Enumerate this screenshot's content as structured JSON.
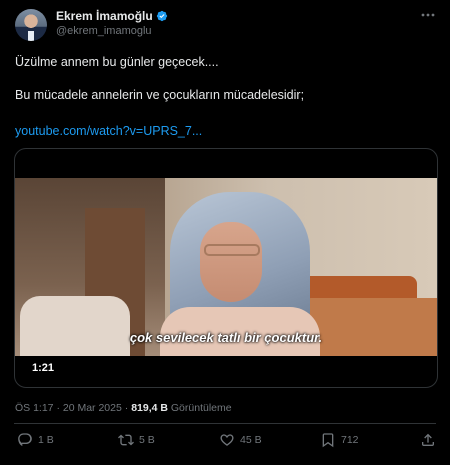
{
  "header": {
    "name": "Ekrem İmamoğlu",
    "handle": "@ekrem_imamoglu"
  },
  "body": {
    "line1": "Üzülme annem bu günler geçecek....",
    "line2": "Bu mücadele annelerin ve çocukların mücadelesidir;",
    "link": "youtube.com/watch?v=UPRS_7..."
  },
  "media": {
    "subtitle": "çok sevilecek tatlı bir çocuktur.",
    "duration": "1:21"
  },
  "meta": {
    "time": "ÖS 1:17",
    "date": "20 Mar 2025",
    "views": "819,4 B",
    "views_label": "Görüntüleme"
  },
  "actions": {
    "replies": "1 B",
    "reposts": "5 B",
    "likes": "45 B",
    "views": "712"
  },
  "colors": {
    "accent": "#1d9bf0",
    "muted": "#71767b",
    "text": "#e7e9ea",
    "border": "#2f3336",
    "background": "#000000"
  },
  "icons": [
    "verified-badge-icon",
    "more-icon",
    "reply-icon",
    "repost-icon",
    "like-icon",
    "views-icon",
    "share-icon"
  ]
}
